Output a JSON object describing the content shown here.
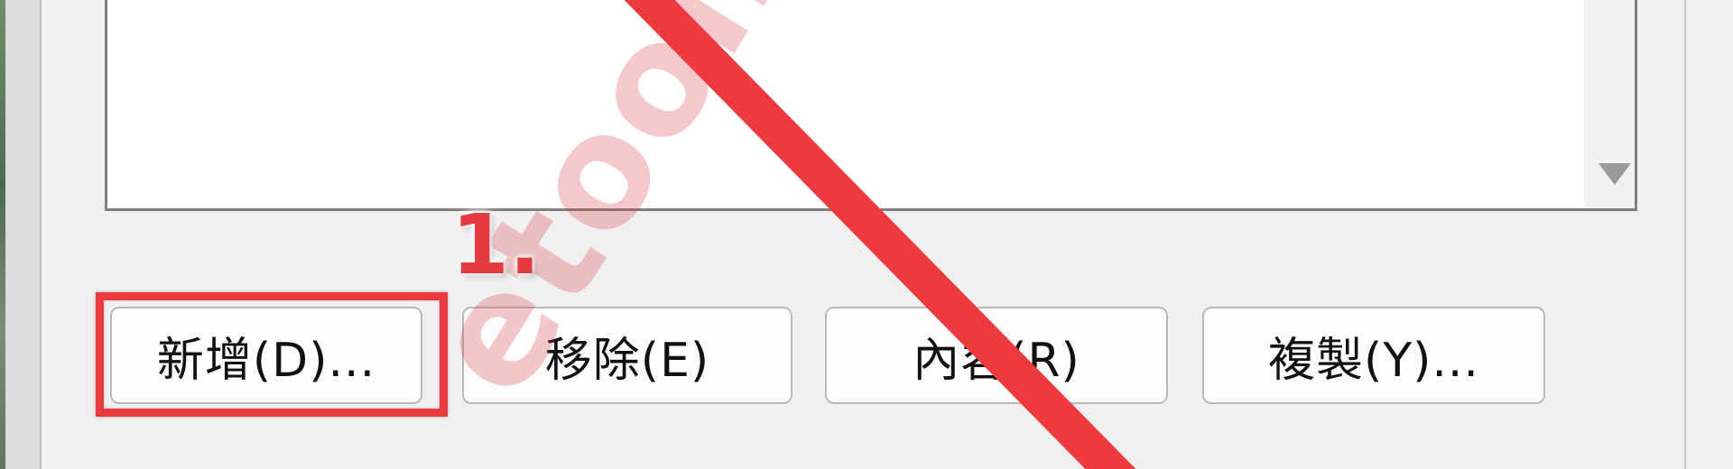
{
  "buttons": {
    "add_label": "新增(D)...",
    "remove_label": "移除(E)",
    "properties_label": "內容(R)",
    "copy_label": "複製(Y)..."
  },
  "annotation": {
    "step_label": "1.",
    "highlight_color": "#ee3a3f"
  },
  "watermark": {
    "text": "etoolbo"
  },
  "icons": {
    "scroll_down": "scroll-down-arrow-icon"
  }
}
